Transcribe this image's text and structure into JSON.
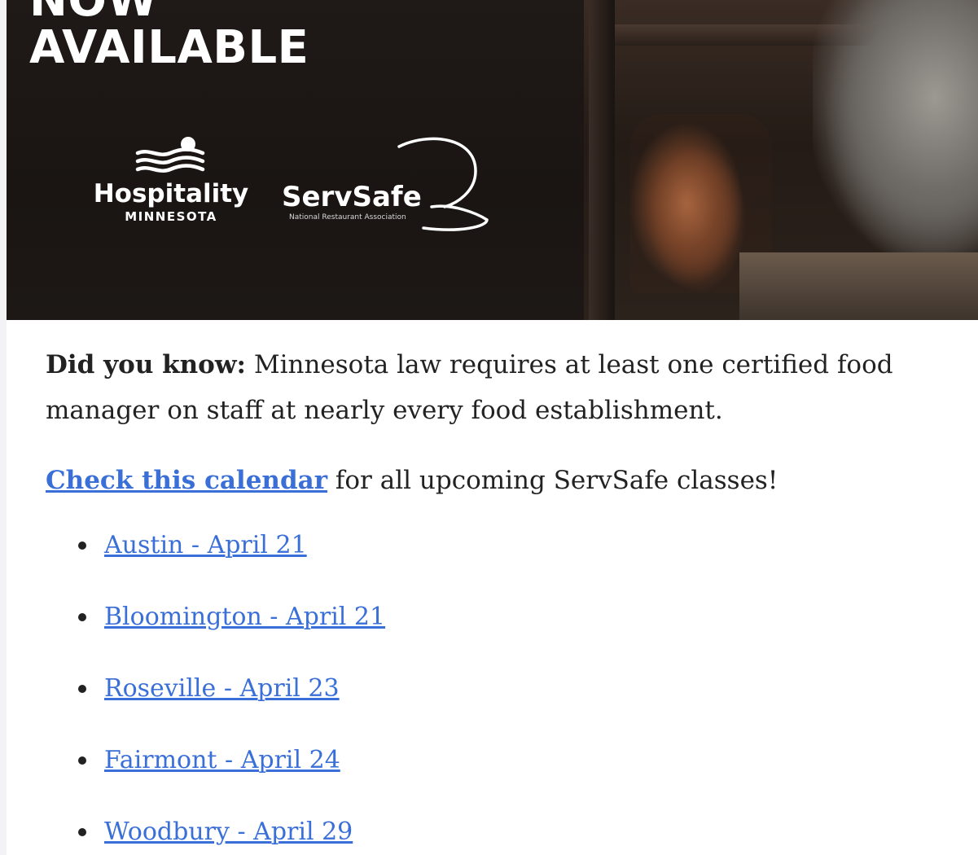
{
  "banner": {
    "headline_line1": "NOW",
    "headline_line2": "AVAILABLE",
    "logo_hospitality": {
      "name": "Hospitality",
      "sub": "MINNESOTA"
    },
    "logo_servsafe": {
      "name": "ServSafe",
      "sub": "National Restaurant Association"
    }
  },
  "body": {
    "intro_bold": "Did you know:",
    "intro_text": " Minnesota law requires at least one certified food manager on staff at nearly every food establishment.",
    "calendar_link": "Check this calendar",
    "calendar_text": " for all upcoming ServSafe classes!",
    "classes": [
      {
        "label": "Austin - April 21"
      },
      {
        "label": "Bloomington - April 21"
      },
      {
        "label": "Roseville - April 23"
      },
      {
        "label": "Fairmont - April 24"
      },
      {
        "label": "Woodbury - April 29"
      }
    ]
  },
  "colors": {
    "link": "#3a6fd8",
    "text": "#222222",
    "banner_bg": "#1c1715",
    "page_bg": "#f3f3f5"
  }
}
